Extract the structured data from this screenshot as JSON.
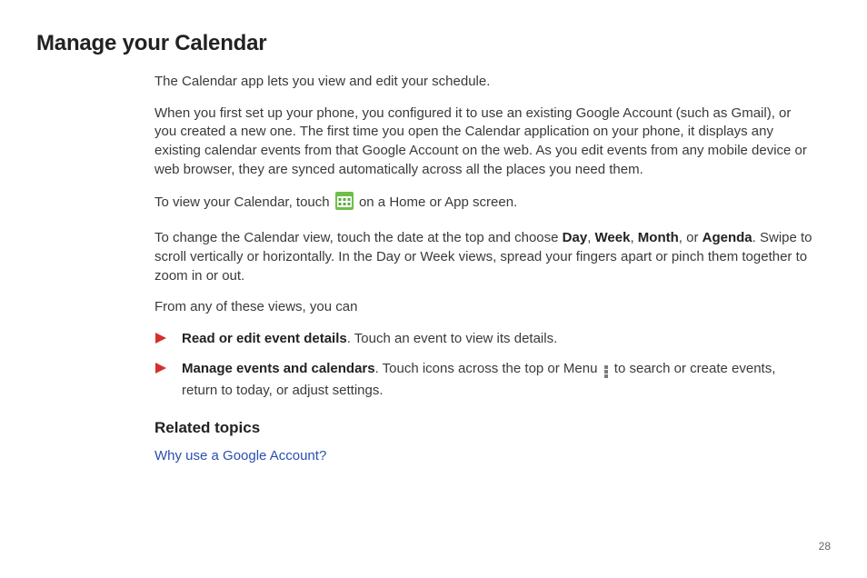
{
  "title": "Manage your Calendar",
  "paragraphs": {
    "p1": "The Calendar app lets you view and edit your schedule.",
    "p2": "When you first set up your phone, you configured it to use an existing Google Account (such as Gmail), or you created a new one. The first time you open the Calendar application on your phone, it displays any existing calendar events from that Google Account on the web. As you edit events from any mobile device or web browser, they are synced automatically across all the places you need them.",
    "p3_pre": "To view your Calendar, touch ",
    "p3_post": " on a Home or App screen.",
    "p4_pre": "To change the Calendar view, touch the date at the top and choose ",
    "p4_day": "Day",
    "p4_sep1": ", ",
    "p4_week": "Week",
    "p4_sep2": ", ",
    "p4_month": "Month",
    "p4_sep3": ", or ",
    "p4_agenda": "Agenda",
    "p4_post": ". Swipe to scroll vertically or horizontally. In the Day or Week views, spread your fingers apart or pinch them together to zoom in or out.",
    "p5": "From any of these views, you can"
  },
  "list": {
    "item1_bold": "Read or edit event details",
    "item1_rest": ". Touch an event to view its details.",
    "item2_bold": "Manage events and calendars",
    "item2_rest_pre": ". Touch icons across the top or Menu",
    "item2_rest_post": " to search or create events, return to today, or adjust settings."
  },
  "related": {
    "heading": "Related topics",
    "link1": "Why use a Google Account?"
  },
  "page_number": "28"
}
